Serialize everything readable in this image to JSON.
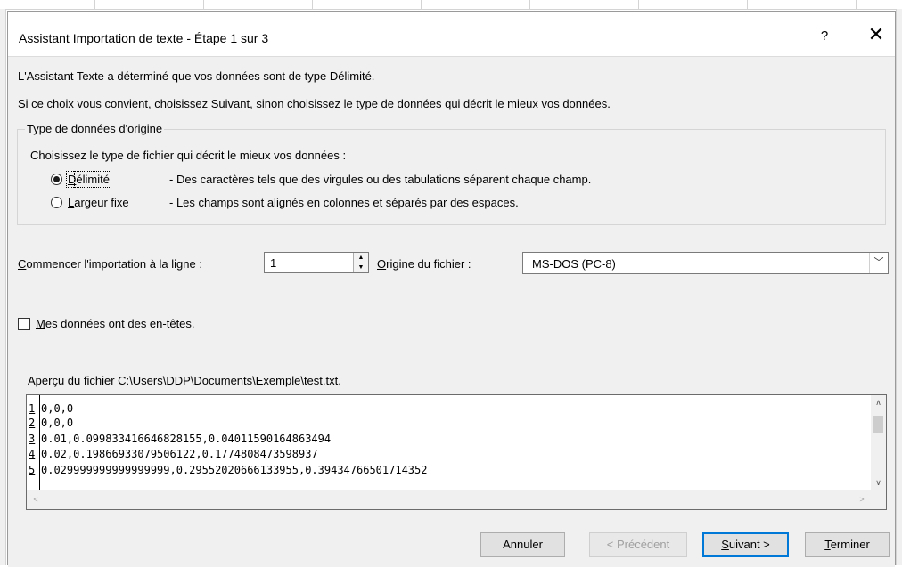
{
  "dialog": {
    "title": "Assistant Importation de texte - Étape 1 sur 3",
    "help_label": "?",
    "close_label": "✕"
  },
  "intro": {
    "line1": "L'Assistant Texte a déterminé que vos données sont de type Délimité.",
    "line2": "Si ce choix vous convient, choisissez Suivant, sinon choisissez le type de données qui décrit le mieux vos données."
  },
  "data_type_group": {
    "title": "Type de données d'origine",
    "description": "Choisissez le type de fichier qui décrit le mieux vos données :",
    "options": [
      {
        "label_accel": "D",
        "label_rest": "élimité",
        "description": "- Des caractères tels que des virgules ou des tabulations séparent chaque champ.",
        "selected": true
      },
      {
        "label_accel": "L",
        "label_rest": "argeur fixe",
        "description": "- Les champs sont alignés en colonnes et séparés par des espaces.",
        "selected": false
      }
    ]
  },
  "start_row": {
    "label_accel": "C",
    "label_rest": "ommencer l'importation à la ligne :",
    "value": "1"
  },
  "file_origin": {
    "label_accel": "O",
    "label_rest": "rigine du fichier :",
    "value": "MS-DOS (PC-8)"
  },
  "headers_checkbox": {
    "label_accel": "M",
    "label_rest": "es données ont des en-têtes.",
    "checked": false
  },
  "preview": {
    "label": "Aperçu du fichier C:\\Users\\DDP\\Documents\\Exemple\\test.txt.",
    "lines": [
      {
        "num": "1",
        "text": "0,0,0"
      },
      {
        "num": "2",
        "text": "0,0,0"
      },
      {
        "num": "3",
        "text": "0.01,0.099833416646828155,0.04011590164863494"
      },
      {
        "num": "4",
        "text": "0.02,0.19866933079506122,0.1774808473598937"
      },
      {
        "num": "5",
        "text": "0.029999999999999999,0.29552020666133955,0.39434766501714352"
      }
    ]
  },
  "buttons": {
    "cancel": "Annuler",
    "previous": "< Précédent",
    "next_accel": "S",
    "next_rest": "uivant >",
    "finish_accel": "T",
    "finish_rest": "erminer"
  },
  "icons": {
    "spin_up": "▲",
    "spin_down": "▼",
    "combo_arrow": "﹀",
    "scroll_up": "∧",
    "scroll_down": "∨",
    "scroll_left": "<",
    "scroll_right": ">"
  }
}
